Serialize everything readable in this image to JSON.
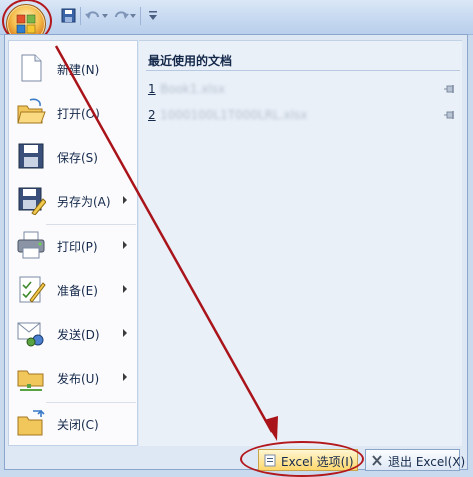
{
  "quick_access": {
    "save": "save-icon",
    "undo": "undo-icon",
    "redo": "redo-icon",
    "customize": "dropdown-icon"
  },
  "menu": {
    "items": [
      {
        "label": "新建(N)",
        "icon": "new-document-icon",
        "has_submenu": false
      },
      {
        "label": "打开(O)",
        "icon": "open-folder-icon",
        "has_submenu": false
      },
      {
        "label": "保存(S)",
        "icon": "save-disk-icon",
        "has_submenu": false
      },
      {
        "label": "另存为(A)",
        "icon": "save-as-icon",
        "has_submenu": true
      },
      {
        "label": "打印(P)",
        "icon": "printer-icon",
        "has_submenu": true
      },
      {
        "label": "准备(E)",
        "icon": "prepare-icon",
        "has_submenu": true
      },
      {
        "label": "发送(D)",
        "icon": "send-icon",
        "has_submenu": true
      },
      {
        "label": "发布(U)",
        "icon": "publish-icon",
        "has_submenu": true
      },
      {
        "label": "关闭(C)",
        "icon": "close-folder-icon",
        "has_submenu": false
      }
    ]
  },
  "recent": {
    "title": "最近使用的文档",
    "items": [
      {
        "number": "1",
        "name": "Book1.xlsx"
      },
      {
        "number": "2",
        "name": "1000100L1T000LRL.xlsx"
      }
    ]
  },
  "buttons": {
    "options": "Excel 选项(I)",
    "exit": "退出 Excel(X)"
  },
  "colors": {
    "highlight": "#b3181d",
    "menu_bg": "#dee8f5",
    "ribbon_blue": "#c8daf1"
  }
}
